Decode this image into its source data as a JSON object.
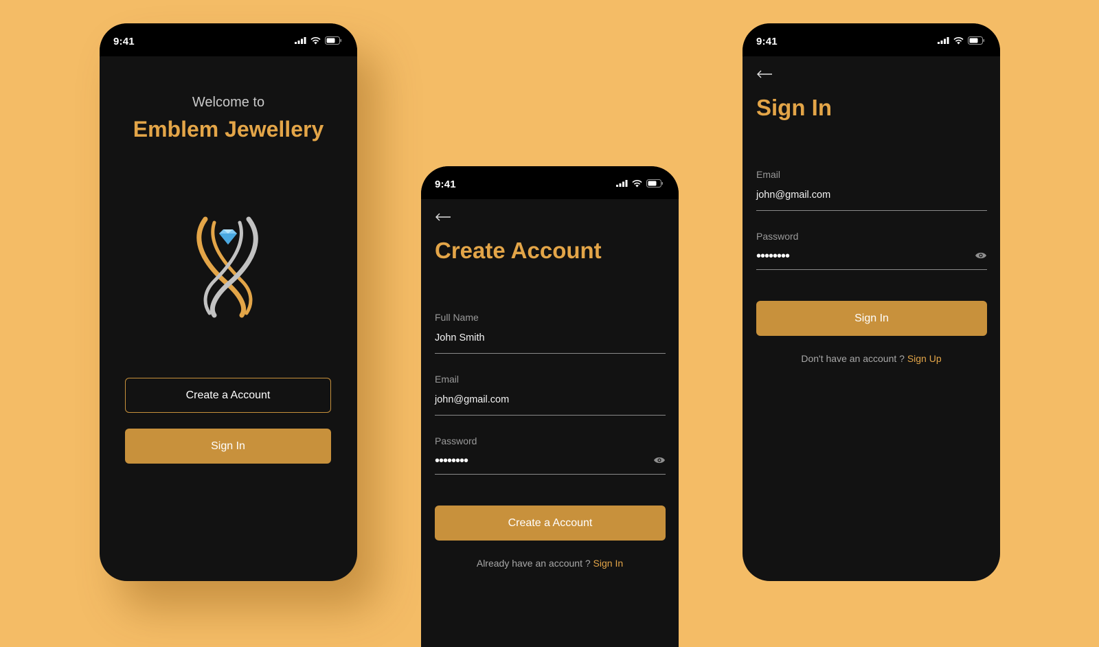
{
  "status_bar": {
    "time": "9:41"
  },
  "welcome": {
    "greeting": "Welcome to",
    "brand": "Emblem Jewellery",
    "create_button": "Create a Account",
    "signin_button": "Sign In"
  },
  "create_account": {
    "title": "Create Account",
    "full_name_label": "Full Name",
    "full_name_value": "John Smith",
    "email_label": "Email",
    "email_value": "john@gmail.com",
    "password_label": "Password",
    "password_value": "••••••••",
    "submit_button": "Create a Account",
    "footer_text": "Already have an account ?",
    "footer_link": "Sign In"
  },
  "sign_in": {
    "title": "Sign In",
    "email_label": "Email",
    "email_value": "john@gmail.com",
    "password_label": "Password",
    "password_value": "••••••••",
    "submit_button": "Sign In",
    "footer_text": "Don't have an account ?",
    "footer_link": "Sign Up"
  },
  "colors": {
    "background": "#F4BC66",
    "screen": "#121212",
    "accent": "#E3A548",
    "button": "#C8913C"
  },
  "icons": [
    "signal-icon",
    "wifi-icon",
    "battery-icon",
    "back-arrow-icon",
    "eye-icon",
    "emblem-logo"
  ]
}
